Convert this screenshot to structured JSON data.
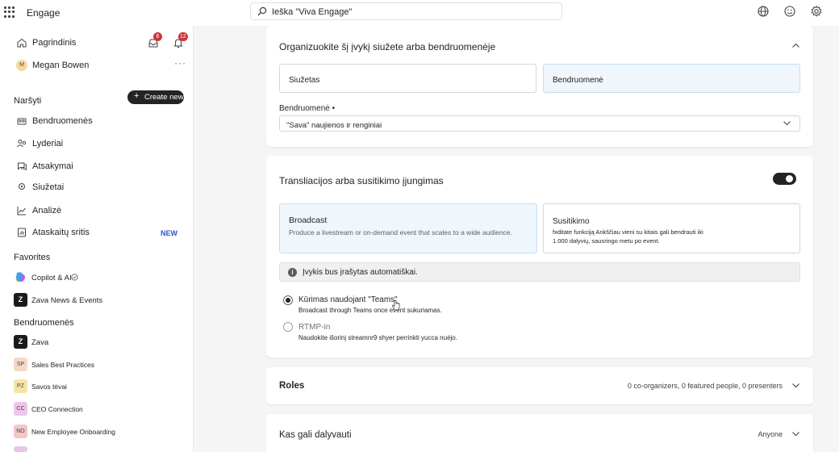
{
  "app": {
    "name": "Engage"
  },
  "search": {
    "placeholder": "Ieška \"Viva Engage\""
  },
  "sidebar": {
    "home": "Pagrindinis",
    "user": "Megan Bowen",
    "user_initial": "M",
    "notifications": {
      "inbox_count": "6",
      "bell_count": "12"
    },
    "browse_title": "Naršyti",
    "create_new": "Create new",
    "nav_items": [
      {
        "label": "Bendruomenės",
        "icon": "communities-icon"
      },
      {
        "label": "Lyderiai",
        "icon": "people-icon"
      },
      {
        "label": "Atsakymai",
        "icon": "answers-icon"
      },
      {
        "label": "Siužetai",
        "icon": "storylines-icon"
      },
      {
        "label": "Analizė",
        "icon": "analytics-icon"
      },
      {
        "label": "Ataskaitų sritis",
        "icon": "report-icon",
        "badge": "NEW"
      }
    ],
    "favorites_title": "Favorites",
    "favorites": [
      {
        "label": "Copilot & AI",
        "icon": "copilot-icon"
      },
      {
        "label": "Zava News & Events",
        "initials": "Z"
      }
    ],
    "communities_title": "Bendruomenės",
    "communities": [
      {
        "label": "Zava",
        "initials": "Z",
        "color": "#1b1b1b"
      },
      {
        "label": "Sales Best Practices",
        "initials": "SP",
        "color": "#f4d9c8"
      },
      {
        "label": "Savos tėvai",
        "initials": "PZ",
        "color": "#f3e6a9"
      },
      {
        "label": "CEO Connection",
        "initials": "CC",
        "color": "#f1c4ea"
      },
      {
        "label": "New Employee Onboarding",
        "initials": "NO",
        "color": "#f2c7c7"
      }
    ]
  },
  "organize": {
    "title": "Organizuokite šį įvykį siužete arba bendruomenėje",
    "option_storyline": "Siužetas",
    "option_community": "Bendruomenė",
    "community_label": "Bendruomenė •",
    "community_value": "\"Sava\" naujienos ir renginiai"
  },
  "broadcast": {
    "title": "Transliacijos arba susitikimo įjungimas",
    "toggle_on": true,
    "broadcast_title": "Broadcast",
    "broadcast_desc": "Produce a livestream or on-demand event that scales to a wide audience.",
    "meeting_title": "Susitikimo",
    "meeting_desc": "fxditate funkciją Ankščiau vieni su kitais gali bendrauti iki 1.000 dalyvių, sausringo metu po event.",
    "info": "Įvykis bus įrašytas automatiškai.",
    "radio_teams": "Kūrimas naudojant \"Teams\"",
    "radio_teams_sub": "Broadcast through Teams once event sukuriamas.",
    "radio_rtmp": "RTMP-in",
    "radio_rtmp_sub": "Naudokite išorinį streamnr9 shyer perrinkti yucca nuėjo."
  },
  "roles": {
    "title": "Roles",
    "summary": "0 co-organizers, 0 featured people, 0 presenters"
  },
  "attend": {
    "title": "Kas gali dalyvauti",
    "value": "Anyone"
  }
}
